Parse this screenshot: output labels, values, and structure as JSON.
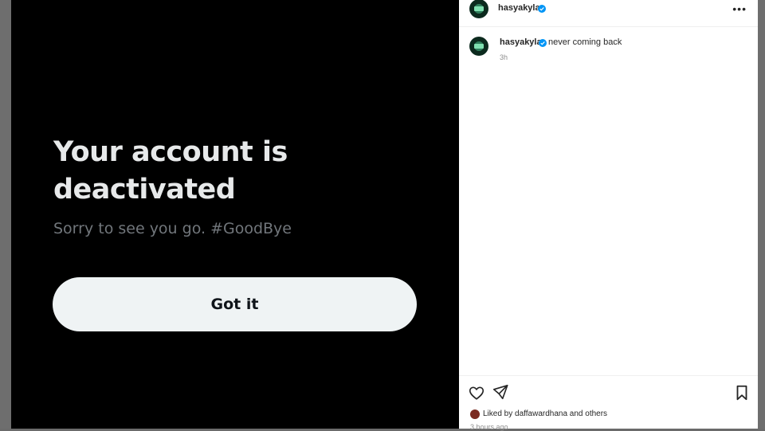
{
  "media": {
    "headline": "Your account is deactivated",
    "subtext": "Sorry to see you go. #GoodBye",
    "button_label": "Got it"
  },
  "post": {
    "username": "hasyakyla",
    "more_icon": "more-horizontal-icon",
    "caption": {
      "username": "hasyakyla",
      "text": "never coming back",
      "time": "3h"
    },
    "likes": {
      "prefix": "Liked by",
      "user": "daffawardhana",
      "suffix": "and others"
    },
    "timestamp": "3 hours ago"
  },
  "colors": {
    "media_bg": "#000000",
    "headline": "#e7e9ea",
    "subtext": "#71767b",
    "button_bg": "#eff3f4",
    "verified": "#0095f6"
  }
}
